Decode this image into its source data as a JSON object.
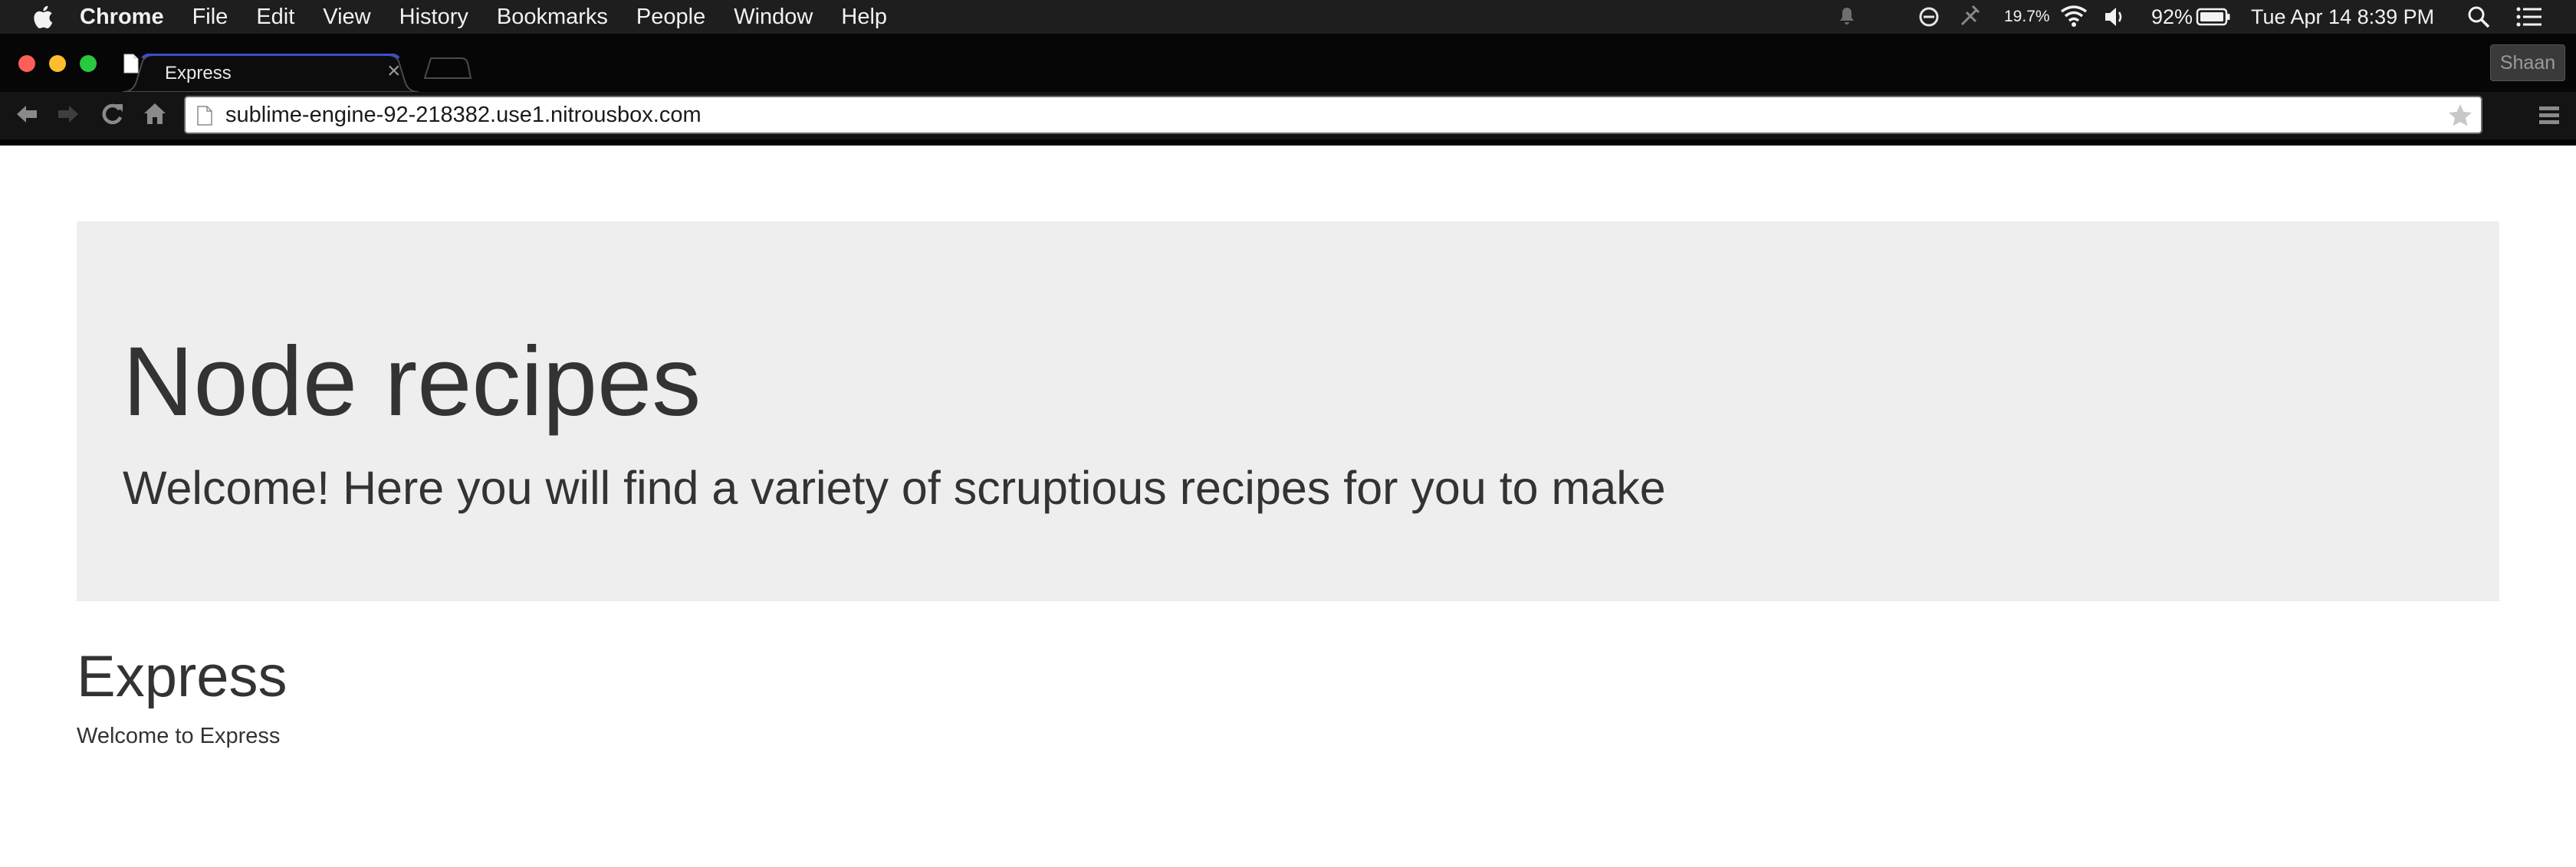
{
  "menubar": {
    "items": [
      "Chrome",
      "File",
      "Edit",
      "View",
      "History",
      "Bookmarks",
      "People",
      "Window",
      "Help"
    ],
    "status": {
      "cpu": "19.7%",
      "battery": "92%",
      "datetime": "Tue Apr 14  8:39 PM"
    }
  },
  "browser": {
    "tab_title": "Express",
    "tab_close": "×",
    "profile": "Shaan",
    "url": "sublime-engine-92-218382.use1.nitrousbox.com",
    "colors": {
      "tab_accent": "#3a4fc8",
      "close": "#ff5f57",
      "minimize": "#ffbd2e",
      "maximize": "#28c840"
    }
  },
  "page": {
    "jumbotron_title": "Node recipes",
    "jumbotron_subtitle": "Welcome! Here you will find a variety of scruptious recipes for you to make",
    "heading": "Express",
    "text": "Welcome to Express"
  }
}
